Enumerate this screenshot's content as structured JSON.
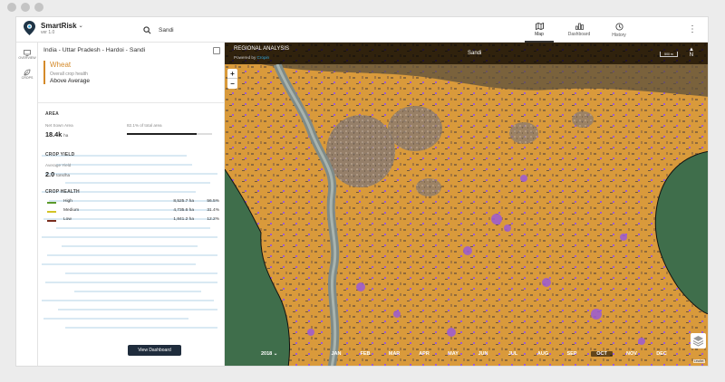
{
  "app": {
    "name": "SmartRisk",
    "version": "ver 1.0"
  },
  "search": {
    "value": "Sandi",
    "placeholder": ""
  },
  "nav": {
    "tabs": [
      {
        "label": "Map",
        "icon": "map-icon",
        "active": true
      },
      {
        "label": "Dashboard",
        "icon": "bar-chart-icon",
        "active": false
      },
      {
        "label": "History",
        "icon": "history-icon",
        "active": false
      }
    ]
  },
  "rail": {
    "items": [
      {
        "label": "OVERVIEW",
        "icon": "monitor-icon"
      },
      {
        "label": "CROPS",
        "icon": "leaf-icon"
      }
    ]
  },
  "panel": {
    "location": "India - Uttar Pradesh - Hardoi - Sandi",
    "crop": {
      "name": "Wheat",
      "health_label": "Overall crop health",
      "health_value": "Above Average"
    },
    "area": {
      "title": "AREA",
      "net_sown_label": "Net Sown Area",
      "net_sown_value": "18.4k",
      "net_sown_unit": "ha",
      "share_text": "82.1% of total area",
      "share_fraction": 0.821
    },
    "yield": {
      "title": "CROP YIELD",
      "label": "Average Yield",
      "value": "2.0",
      "unit": "tons/ha"
    },
    "health": {
      "title": "CROP HEALTH",
      "rows": [
        {
          "name": "High",
          "area": "8,525.7 ha",
          "percent": "56.5%",
          "color": "#5b9a2b"
        },
        {
          "name": "Medium",
          "area": "4,735.6 ha",
          "percent": "31.4%",
          "color": "#d3c326"
        },
        {
          "name": "Low",
          "area": "1,841.2 ha",
          "percent": "12.2%",
          "color": "#7a2e1e"
        }
      ]
    },
    "button": "View Dashboard"
  },
  "map": {
    "title": "REGIONAL ANALYSIS",
    "powered_prefix": "Powered by",
    "powered_brand": "Cropin",
    "place": "Sandi",
    "scale": "500 m",
    "north": "N",
    "zoom_in": "+",
    "zoom_out": "−",
    "year": "2018",
    "months": [
      "JAN",
      "FEB",
      "MAR",
      "APR",
      "MAY",
      "JUN",
      "JUL",
      "AUG",
      "SEP",
      "OCT",
      "NOV",
      "DEC"
    ],
    "active_month": "OCT",
    "attribution": "Leaflet",
    "colors": {
      "crop_fill": "#d89a3a",
      "stress": "#9b5bd6",
      "field_green": "#3f6e4b"
    }
  }
}
